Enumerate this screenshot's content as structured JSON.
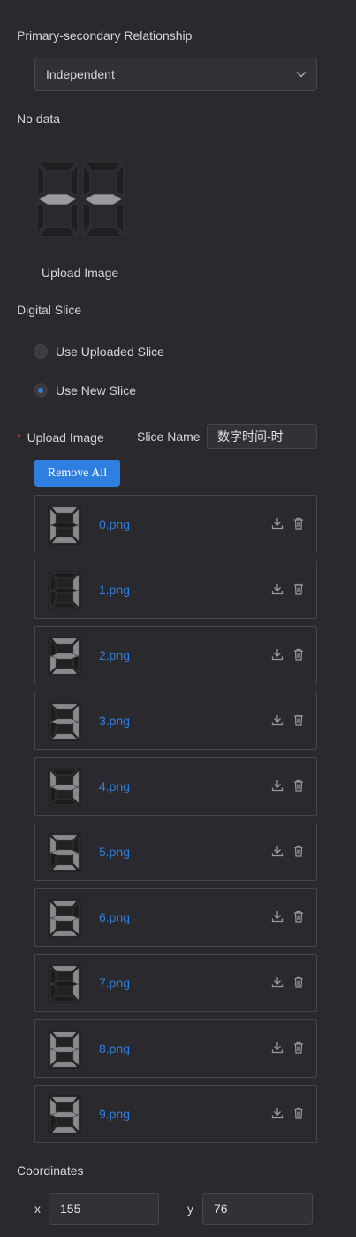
{
  "relationship": {
    "label": "Primary-secondary Relationship",
    "selected": "Independent"
  },
  "preview": {
    "empty_text": "No data",
    "upload_label": "Upload Image"
  },
  "digital_slice": {
    "label": "Digital Slice",
    "options": [
      {
        "label": "Use Uploaded Slice",
        "selected": false
      },
      {
        "label": "Use New Slice",
        "selected": true
      }
    ]
  },
  "upload": {
    "required_mark": "*",
    "label": "Upload Image",
    "slice_name_label": "Slice Name",
    "slice_name_value": "数字时间-时",
    "remove_all": "Remove All",
    "files": [
      {
        "name": "0.png",
        "digit": 0
      },
      {
        "name": "1.png",
        "digit": 1
      },
      {
        "name": "2.png",
        "digit": 2
      },
      {
        "name": "3.png",
        "digit": 3
      },
      {
        "name": "4.png",
        "digit": 4
      },
      {
        "name": "5.png",
        "digit": 5
      },
      {
        "name": "6.png",
        "digit": 6
      },
      {
        "name": "7.png",
        "digit": 7
      },
      {
        "name": "8.png",
        "digit": 8
      },
      {
        "name": "9.png",
        "digit": 9
      }
    ]
  },
  "coordinates": {
    "label": "Coordinates",
    "x_label": "x",
    "x_value": "155",
    "y_label": "y",
    "y_value": "76"
  },
  "colors": {
    "accent": "#2f7fe0",
    "segment_on": "#8a8a8e",
    "segment_off": "#1c1c1e"
  }
}
